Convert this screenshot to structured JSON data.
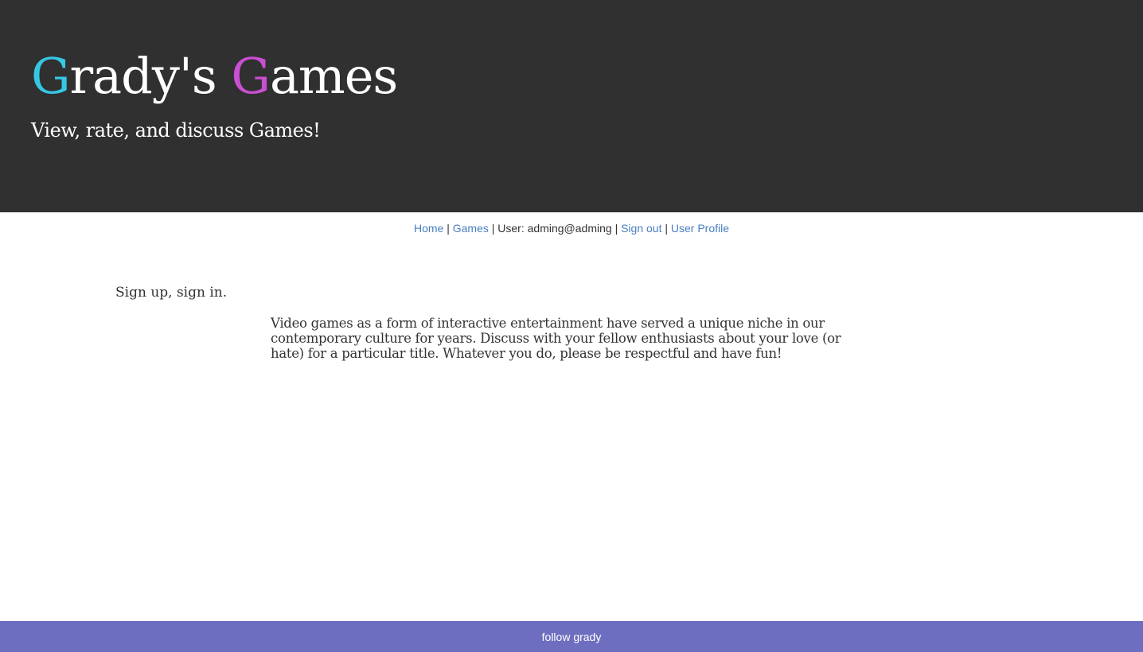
{
  "header": {
    "title_first_letter": "G",
    "title_first_rest": "rady's ",
    "title_second_letter": "G",
    "title_second_rest": "ames",
    "tagline": "View, rate, and discuss Games!"
  },
  "nav": {
    "home": "Home",
    "games": "Games",
    "user_text": "User: adming@adming",
    "sign_out": "Sign out",
    "user_profile": "User Profile",
    "separator": "|"
  },
  "main": {
    "signin_text": "Sign up, sign in.",
    "intro": "Video games as a form of interactive entertainment have served a unique niche in our contemporary culture for years. Discuss with your fellow enthusiasts about your love (or hate) for a particular title. Whatever you do, please be respectful and have fun!"
  },
  "footer": {
    "link": "follow grady"
  },
  "colors": {
    "header_bg": "#303030",
    "accent1": "#35c7e4",
    "accent2": "#c94fd3",
    "link": "#4a7fc0",
    "footer_bg": "#6e6ec0"
  }
}
